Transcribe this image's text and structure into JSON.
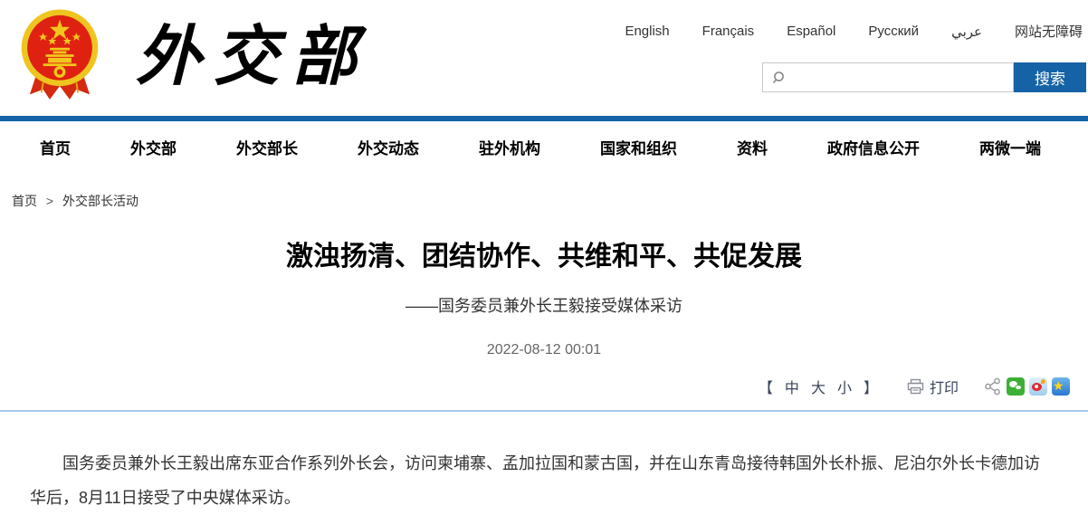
{
  "header": {
    "site_name_calligraphy": "外交部",
    "languages": [
      "English",
      "Français",
      "Español",
      "Русский",
      "عربي",
      "网站无障碍"
    ],
    "search": {
      "value": "",
      "button_label": "搜索"
    }
  },
  "nav": {
    "items": [
      "首页",
      "外交部",
      "外交部长",
      "外交动态",
      "驻外机构",
      "国家和组织",
      "资料",
      "政府信息公开",
      "两微一端"
    ]
  },
  "breadcrumb": {
    "home": "首页",
    "separator": ">",
    "current": "外交部长活动"
  },
  "article": {
    "title": "激浊扬清、团结协作、共维和平、共促发展",
    "subtitle": "——国务委员兼外长王毅接受媒体采访",
    "date": "2022-08-12 00:01",
    "body": "国务委员兼外长王毅出席东亚合作系列外长会，访问柬埔寨、孟加拉国和蒙古国，并在山东青岛接待韩国外长朴振、尼泊尔外长卡德加访华后，8月11日接受了中央媒体采访。"
  },
  "toolbar": {
    "bracket_open": "【",
    "font_medium": "中",
    "font_large": "大",
    "font_small": "小",
    "bracket_close": "】",
    "print_label": "打印",
    "share_icons": [
      "share-icon",
      "wechat-icon",
      "weibo-icon",
      "qzone-icon"
    ]
  },
  "colors": {
    "primary_blue": "#1562a6",
    "divider_blue": "#a8cde9",
    "wechat_green": "#3cb035",
    "weibo_red": "#e6262d",
    "qzone_blue": "#2a77cf",
    "qzone_star_yellow": "#ffd813"
  }
}
